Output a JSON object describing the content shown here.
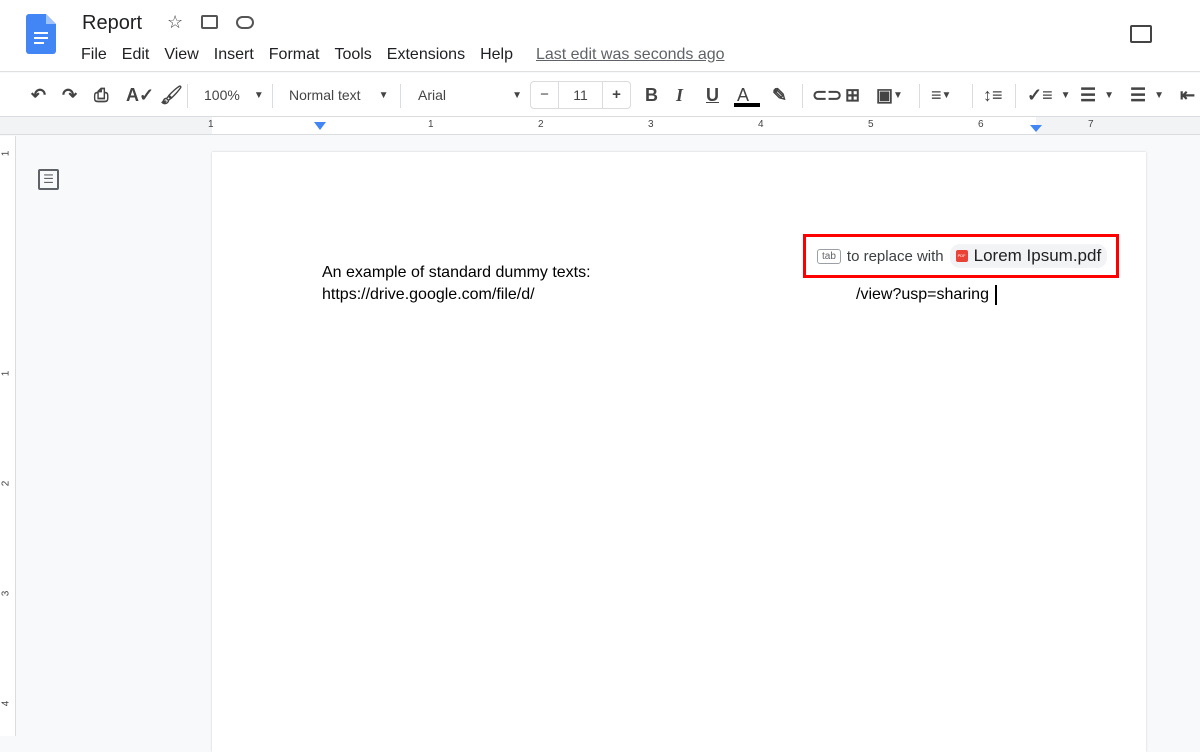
{
  "header": {
    "title": "Report",
    "menu": [
      "File",
      "Edit",
      "View",
      "Insert",
      "Format",
      "Tools",
      "Extensions",
      "Help"
    ],
    "last_edit": "Last edit was seconds ago"
  },
  "toolbar": {
    "zoom": "100%",
    "style": "Normal text",
    "font": "Arial",
    "font_size": "11",
    "minus": "−",
    "plus": "+",
    "bold": "B",
    "italic": "I",
    "underline": "U",
    "text_color": "A",
    "text_color_value": "#000000"
  },
  "ruler": {
    "labels": [
      "1",
      "1",
      "2",
      "3",
      "4",
      "5",
      "6",
      "7"
    ]
  },
  "vruler": {
    "labels": [
      "1",
      "1",
      "2",
      "3",
      "4"
    ]
  },
  "document": {
    "line1": "An example of standard dummy texts:",
    "url_start": "https://drive.google.com/file/d/",
    "url_end": "/view?usp=sharing"
  },
  "suggestion": {
    "key": "tab",
    "text": "to replace with",
    "chip_icon": "PDF",
    "chip_label": "Lorem Ipsum.pdf",
    "highlight_color": "#ff0000"
  }
}
